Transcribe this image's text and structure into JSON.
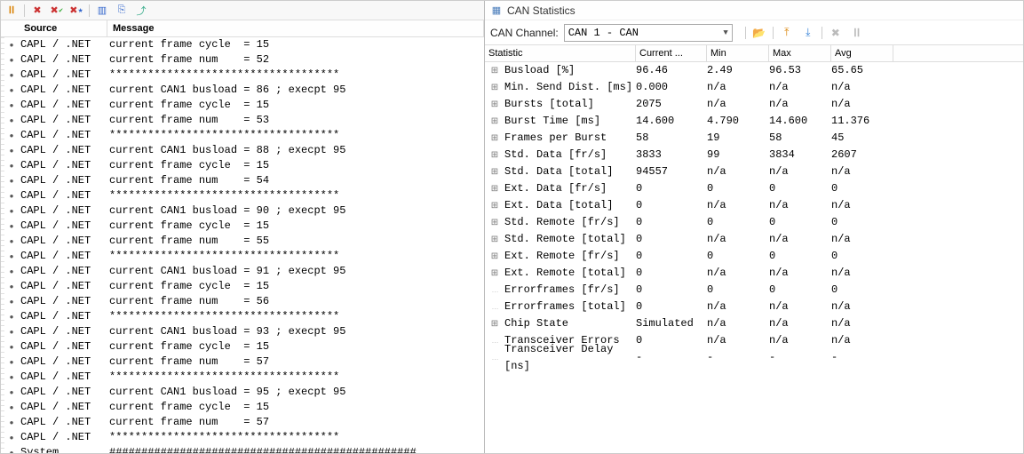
{
  "left": {
    "headers": {
      "source": "Source",
      "message": "Message"
    },
    "rows": [
      {
        "source": "CAPL / .NET",
        "message": "current frame cycle  = 15"
      },
      {
        "source": "CAPL / .NET",
        "message": "current frame num    = 52"
      },
      {
        "source": "CAPL / .NET",
        "message": "************************************"
      },
      {
        "source": "CAPL / .NET",
        "message": "current CAN1 busload = 86 ; execpt 95"
      },
      {
        "source": "CAPL / .NET",
        "message": "current frame cycle  = 15"
      },
      {
        "source": "CAPL / .NET",
        "message": "current frame num    = 53"
      },
      {
        "source": "CAPL / .NET",
        "message": "************************************"
      },
      {
        "source": "CAPL / .NET",
        "message": "current CAN1 busload = 88 ; execpt 95"
      },
      {
        "source": "CAPL / .NET",
        "message": "current frame cycle  = 15"
      },
      {
        "source": "CAPL / .NET",
        "message": "current frame num    = 54"
      },
      {
        "source": "CAPL / .NET",
        "message": "************************************"
      },
      {
        "source": "CAPL / .NET",
        "message": "current CAN1 busload = 90 ; execpt 95"
      },
      {
        "source": "CAPL / .NET",
        "message": "current frame cycle  = 15"
      },
      {
        "source": "CAPL / .NET",
        "message": "current frame num    = 55"
      },
      {
        "source": "CAPL / .NET",
        "message": "************************************"
      },
      {
        "source": "CAPL / .NET",
        "message": "current CAN1 busload = 91 ; execpt 95"
      },
      {
        "source": "CAPL / .NET",
        "message": "current frame cycle  = 15"
      },
      {
        "source": "CAPL / .NET",
        "message": "current frame num    = 56"
      },
      {
        "source": "CAPL / .NET",
        "message": "************************************"
      },
      {
        "source": "CAPL / .NET",
        "message": "current CAN1 busload = 93 ; execpt 95"
      },
      {
        "source": "CAPL / .NET",
        "message": "current frame cycle  = 15"
      },
      {
        "source": "CAPL / .NET",
        "message": "current frame num    = 57"
      },
      {
        "source": "CAPL / .NET",
        "message": "************************************"
      },
      {
        "source": "CAPL / .NET",
        "message": "current CAN1 busload = 95 ; execpt 95"
      },
      {
        "source": "CAPL / .NET",
        "message": "current frame cycle  = 15"
      },
      {
        "source": "CAPL / .NET",
        "message": "current frame num    = 57"
      },
      {
        "source": "CAPL / .NET",
        "message": "************************************"
      },
      {
        "source": "System",
        "message": "################################################"
      }
    ]
  },
  "right": {
    "title": "CAN Statistics",
    "channel_label": "CAN Channel:",
    "channel_value": "CAN 1 - CAN",
    "headers": {
      "stat": "Statistic",
      "cur": "Current ...",
      "min": "Min",
      "max": "Max",
      "avg": "Avg"
    },
    "rows": [
      {
        "exp": true,
        "name": "Busload [%]",
        "cur": "96.46",
        "min": "2.49",
        "max": "96.53",
        "avg": "65.65"
      },
      {
        "exp": true,
        "name": "Min. Send Dist. [ms]",
        "cur": "0.000",
        "min": "n/a",
        "max": "n/a",
        "avg": "n/a"
      },
      {
        "exp": true,
        "name": "Bursts [total]",
        "cur": "2075",
        "min": "n/a",
        "max": "n/a",
        "avg": "n/a"
      },
      {
        "exp": true,
        "name": "Burst Time [ms]",
        "cur": "14.600",
        "min": "4.790",
        "max": "14.600",
        "avg": "11.376"
      },
      {
        "exp": true,
        "name": "Frames per Burst",
        "cur": "58",
        "min": "19",
        "max": "58",
        "avg": "45"
      },
      {
        "exp": true,
        "name": "Std. Data [fr/s]",
        "cur": "3833",
        "min": "99",
        "max": "3834",
        "avg": "2607"
      },
      {
        "exp": true,
        "name": "Std. Data [total]",
        "cur": "94557",
        "min": "n/a",
        "max": "n/a",
        "avg": "n/a"
      },
      {
        "exp": true,
        "name": "Ext. Data [fr/s]",
        "cur": "0",
        "min": "0",
        "max": "0",
        "avg": "0"
      },
      {
        "exp": true,
        "name": "Ext. Data [total]",
        "cur": "0",
        "min": "n/a",
        "max": "n/a",
        "avg": "n/a"
      },
      {
        "exp": true,
        "name": "Std. Remote [fr/s]",
        "cur": "0",
        "min": "0",
        "max": "0",
        "avg": "0"
      },
      {
        "exp": true,
        "name": "Std. Remote [total]",
        "cur": "0",
        "min": "n/a",
        "max": "n/a",
        "avg": "n/a"
      },
      {
        "exp": true,
        "name": "Ext. Remote [fr/s]",
        "cur": "0",
        "min": "0",
        "max": "0",
        "avg": "0"
      },
      {
        "exp": true,
        "name": "Ext. Remote [total]",
        "cur": "0",
        "min": "n/a",
        "max": "n/a",
        "avg": "n/a"
      },
      {
        "exp": false,
        "name": "Errorframes [fr/s]",
        "cur": "0",
        "min": "0",
        "max": "0",
        "avg": "0"
      },
      {
        "exp": false,
        "name": "Errorframes [total]",
        "cur": "0",
        "min": "n/a",
        "max": "n/a",
        "avg": "n/a"
      },
      {
        "exp": true,
        "name": "Chip State",
        "cur": "Simulated",
        "min": "n/a",
        "max": "n/a",
        "avg": "n/a"
      },
      {
        "exp": false,
        "name": "Transceiver Errors",
        "cur": "0",
        "min": "n/a",
        "max": "n/a",
        "avg": "n/a"
      },
      {
        "exp": false,
        "name": "Transceiver Delay [ns]",
        "cur": "-",
        "min": "-",
        "max": "-",
        "avg": "-"
      }
    ]
  }
}
